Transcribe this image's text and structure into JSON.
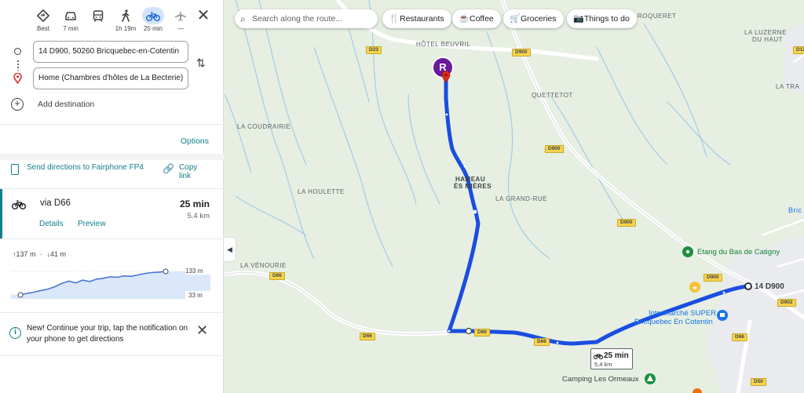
{
  "modes": [
    {
      "name": "best",
      "label": "Best"
    },
    {
      "name": "drive",
      "label": "7 min"
    },
    {
      "name": "transit",
      "label": ""
    },
    {
      "name": "walk",
      "label": "1h 19m"
    },
    {
      "name": "cycle",
      "label": "25 min"
    },
    {
      "name": "flight",
      "label": "—"
    }
  ],
  "origin": {
    "value": "14 D900, 50260 Bricquebec-en-Cotentin"
  },
  "destination": {
    "value": "Home (Chambres d'hôtes de La Becterie)"
  },
  "add_destination": "Add destination",
  "options_label": "Options",
  "send_directions": "Send directions to Fairphone FP4",
  "copy_link": "Copy link",
  "route": {
    "via": "via D66",
    "time": "25 min",
    "distance": "5.4 km",
    "details": "Details",
    "preview": "Preview"
  },
  "elevation": {
    "up": "137 m",
    "down": "41 m",
    "max_label": "133 m",
    "min_label": "33 m",
    "profile": [
      33,
      40,
      45,
      52,
      58,
      68,
      82,
      92,
      84,
      96,
      90,
      100,
      104,
      110,
      108,
      114,
      112,
      118,
      124,
      128,
      130,
      133
    ]
  },
  "notice": "New! Continue your trip, tap the notification on your phone to get directions",
  "search": {
    "placeholder": "Search along the route..."
  },
  "chips": [
    {
      "name": "restaurants",
      "label": "Restaurants"
    },
    {
      "name": "coffee",
      "label": "Coffee"
    },
    {
      "name": "groceries",
      "label": "Groceries"
    },
    {
      "name": "things-to-do",
      "label": "Things to do"
    }
  ],
  "map": {
    "places": [
      "HÔTEL BEUVRIL",
      "QUETTETOT",
      "LA COUDRAIRIE",
      "HAMEAU",
      "ÈS MIÈRES",
      "LA HOULETTE",
      "LA GRAND-RUE",
      "LA VÉNOURIE",
      "ROQUERET",
      "LA LUZERNE",
      "DU HAUT",
      "LA TRA",
      "Bric"
    ],
    "roads": [
      "D23",
      "D900",
      "D900",
      "D900",
      "D900",
      "D66",
      "D66",
      "D66",
      "D66",
      "D66",
      "D902",
      "D50",
      "D12"
    ],
    "pois": {
      "etang": "Etang du Bas de Catigny",
      "intermarche_1": "Intermarché SUPER",
      "intermarche_2": "Bricquebec En Cotentin",
      "camping": "Camping Les Ormeaux"
    },
    "start_label": "14 D900",
    "marker_letter": "R",
    "bubble_time": "25 min",
    "bubble_distance": "5,4 km"
  },
  "colors": {
    "route": "#1a4de0",
    "accent": "#137e8a",
    "map_bg": "#e6efe2",
    "destination_marker": "#6a1b9a"
  }
}
